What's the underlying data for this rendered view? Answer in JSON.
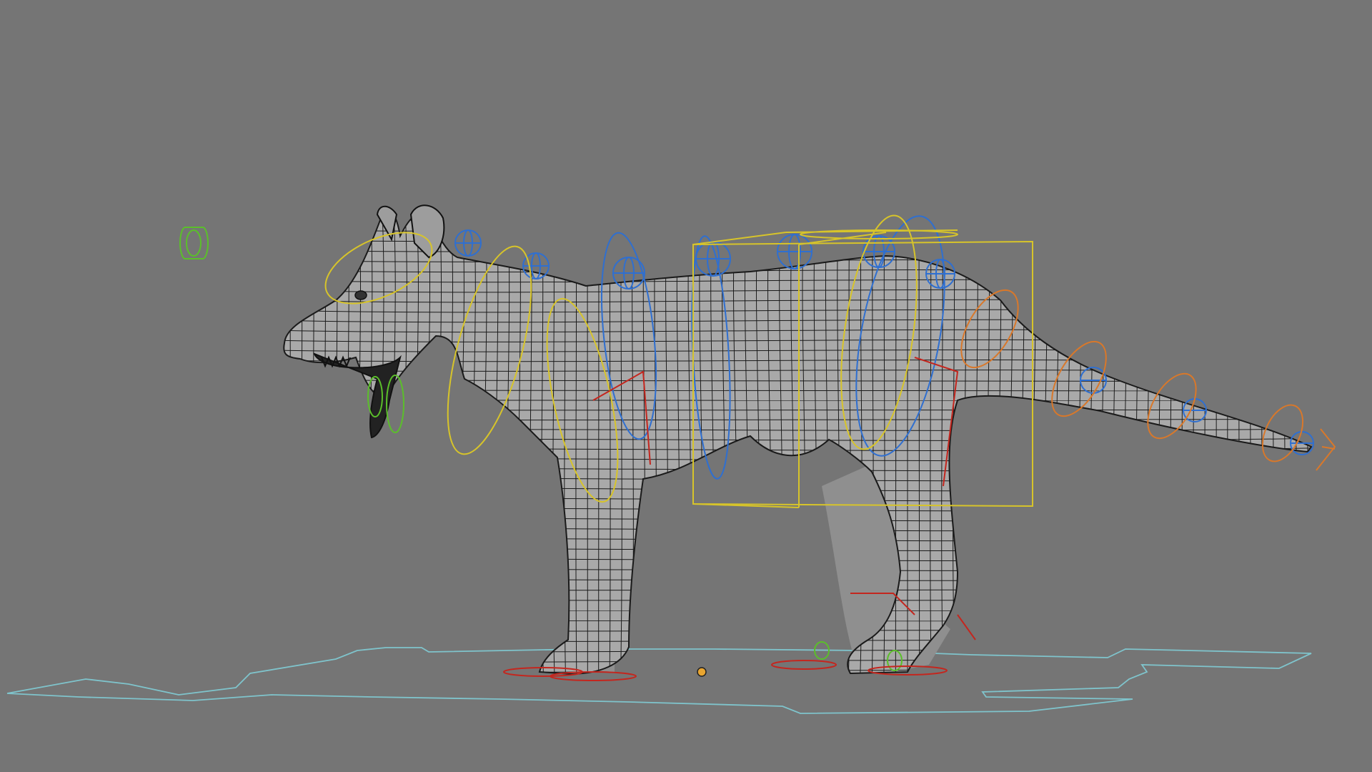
{
  "scene": {
    "background": "#757575",
    "subject": "quadruped-rig",
    "controls": {
      "ik_green": "#5bbf2a",
      "spine_blue": "#2f6fd0",
      "fk_yellow": "#d7c42a",
      "tail_orange": "#d9782a",
      "foot_red": "#c4261e",
      "ground_cyan": "#7fc4cc",
      "pivot_dot": "#e8a531"
    }
  }
}
